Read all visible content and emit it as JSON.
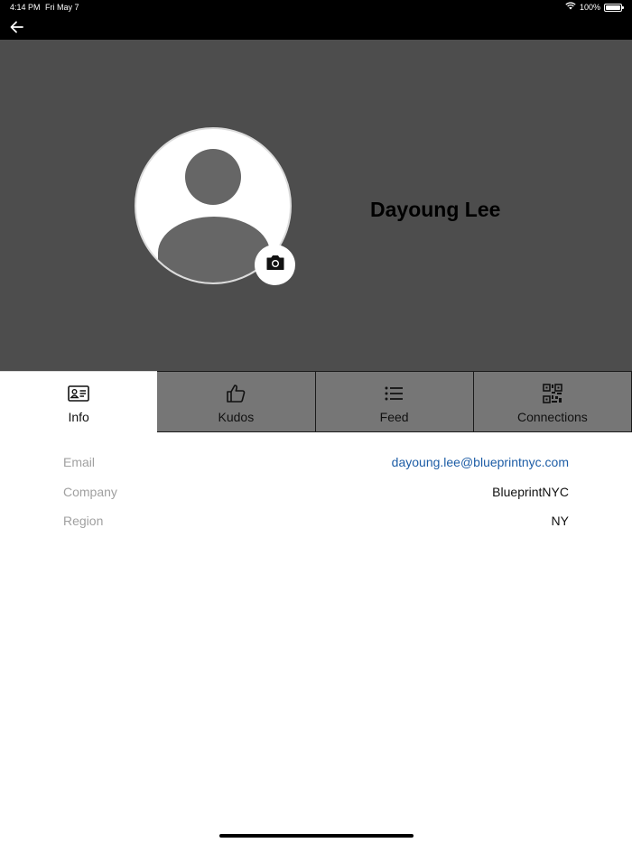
{
  "status_bar": {
    "time": "4:14 PM",
    "date": "Fri May 7",
    "battery": "100%",
    "battery_level": 1.0
  },
  "nav": {
    "back_icon": "arrow-left-icon"
  },
  "profile": {
    "name": "Dayoung Lee",
    "avatar_icon": "person-placeholder-icon",
    "camera_icon": "camera-icon"
  },
  "tabs": [
    {
      "label": "Info",
      "icon": "id-card-icon",
      "active": true
    },
    {
      "label": "Kudos",
      "icon": "thumbs-up-icon",
      "active": false
    },
    {
      "label": "Feed",
      "icon": "list-icon",
      "active": false
    },
    {
      "label": "Connections",
      "icon": "qr-code-icon",
      "active": false
    }
  ],
  "info": [
    {
      "label": "Email",
      "value": "dayoung.lee@blueprintnyc.com"
    },
    {
      "label": "Company",
      "value": "BlueprintNYC"
    },
    {
      "label": "Region",
      "value": "NY"
    }
  ],
  "colors": {
    "header_bg": "#4d4d4d",
    "tab_inactive": "#767676",
    "link": "#1d5da6",
    "label": "#a0a0a0"
  }
}
